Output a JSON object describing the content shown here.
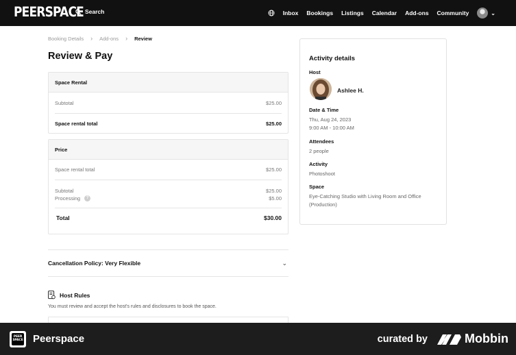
{
  "topnav": {
    "logo": "PEERSPACE",
    "search_label": "Search",
    "items": [
      "Inbox",
      "Bookings",
      "Listings",
      "Calendar",
      "Add-ons",
      "Community"
    ]
  },
  "breadcrumb": [
    "Booking Details",
    "Add-ons",
    "Review"
  ],
  "page_title": "Review & Pay",
  "space_rental": {
    "header": "Space Rental",
    "subtotal_label": "Subtotal",
    "subtotal_value": "$25.00",
    "total_label": "Space rental total",
    "total_value": "$25.00"
  },
  "price": {
    "header": "Price",
    "rental_label": "Space rental total",
    "rental_value": "$25.00",
    "subtotal_label": "Subtotal",
    "subtotal_value": "$25.00",
    "processing_label": "Processing",
    "processing_value": "$5.00",
    "total_label": "Total",
    "total_value": "$30.00"
  },
  "cancellation": {
    "label": "Cancellation Policy: Very Flexible"
  },
  "host_rules": {
    "title": "Host Rules",
    "note": "You must review and accept the host's rules and disclosures to book the space."
  },
  "activity": {
    "title": "Activity details",
    "host_label": "Host",
    "host_name": "Ashlee H.",
    "datetime_label": "Date & Time",
    "date": "Thu, Aug 24, 2023",
    "time": "9:00 AM - 10:00 AM",
    "attendees_label": "Attendees",
    "attendees": "2 people",
    "activity_label": "Activity",
    "activity": "Photoshoot",
    "space_label": "Space",
    "space": "Eye-Catching Studio with Living Room and Office (Production)"
  },
  "footer": {
    "logo_text": "PEER SPACE",
    "app_name": "Peerspace",
    "curated_by": "curated by",
    "brand": "Mobbin"
  }
}
